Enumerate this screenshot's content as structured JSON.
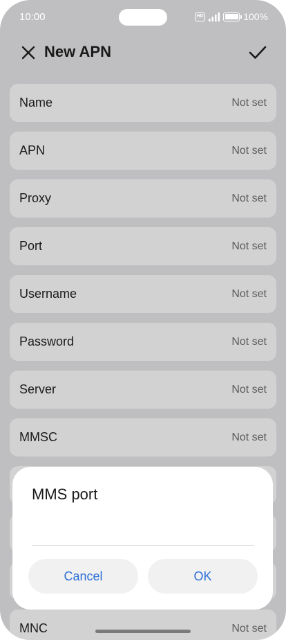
{
  "status_bar": {
    "time": "10:00",
    "hd_label": "HD",
    "battery_percent": "100%"
  },
  "header": {
    "title": "New APN",
    "close_icon": "close-icon",
    "confirm_icon": "check-icon"
  },
  "fields": [
    {
      "label": "Name",
      "value": "Not set"
    },
    {
      "label": "APN",
      "value": "Not set"
    },
    {
      "label": "Proxy",
      "value": "Not set"
    },
    {
      "label": "Port",
      "value": "Not set"
    },
    {
      "label": "Username",
      "value": "Not set"
    },
    {
      "label": "Password",
      "value": "Not set"
    },
    {
      "label": "Server",
      "value": "Not set"
    },
    {
      "label": "MMSC",
      "value": "Not set"
    },
    {
      "label": "MNC",
      "value": "Not set"
    }
  ],
  "dialog": {
    "title": "MMS port",
    "input_value": "",
    "cancel_label": "Cancel",
    "ok_label": "OK"
  },
  "colors": {
    "background_dim": "#bfbfc1",
    "row_bg": "#d3d2d3",
    "accent": "#2d6fd6",
    "dialog_bg": "#ffffff"
  }
}
